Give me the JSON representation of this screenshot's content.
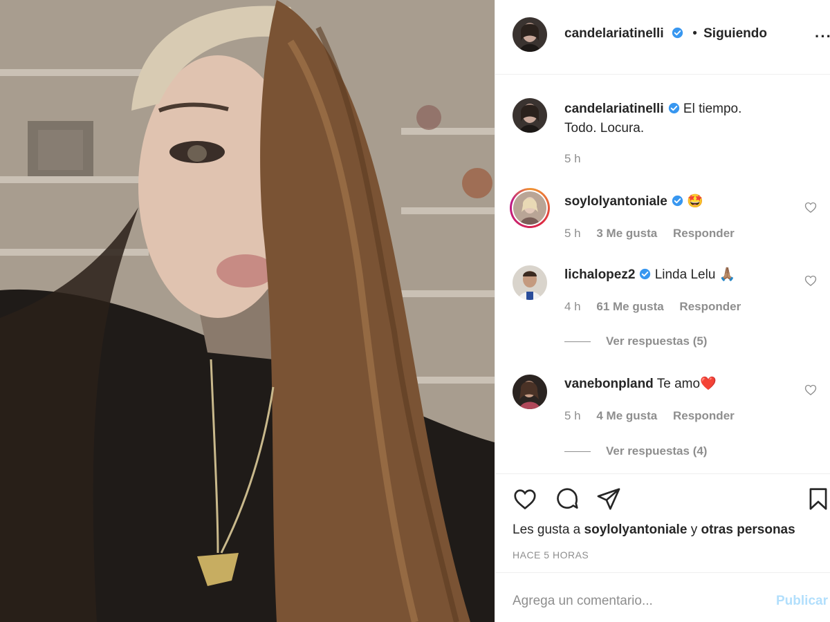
{
  "post": {
    "author": "candelariatinelli",
    "follow_separator": "•",
    "follow_status": "Siguiendo",
    "more_icon": "more-horizontal-icon",
    "verified_color": "#3897f0"
  },
  "caption": {
    "username": "candelariatinelli",
    "text": "El tiempo. Todo. Locura.",
    "time": "5 h"
  },
  "comments": [
    {
      "username": "soylolyantoniale",
      "text": "🤩",
      "time": "5 h",
      "likes": "3 Me gusta",
      "reply": "Responder",
      "verified": true,
      "story_ring": true
    },
    {
      "username": "lichalopez2",
      "text": "Linda Lelu 🙏🏽",
      "time": "4 h",
      "likes": "61 Me gusta",
      "reply": "Responder",
      "verified": true,
      "view_replies": "Ver respuestas (5)"
    },
    {
      "username": "vanebonpland",
      "text": "Te amo❤️",
      "time": "5 h",
      "likes": "4 Me gusta",
      "reply": "Responder",
      "verified": false,
      "view_replies": "Ver respuestas (4)"
    }
  ],
  "actions": {
    "like_icon": "heart-icon",
    "comment_icon": "comment-icon",
    "share_icon": "share-icon",
    "save_icon": "bookmark-icon",
    "likes_prefix": "Les gusta a",
    "likes_user": "soylolyantoniale",
    "likes_join": "y",
    "likes_others": "otras personas",
    "time_ago": "HACE 5 HORAS"
  },
  "composer": {
    "placeholder": "Agrega un comentario...",
    "publish": "Publicar"
  }
}
